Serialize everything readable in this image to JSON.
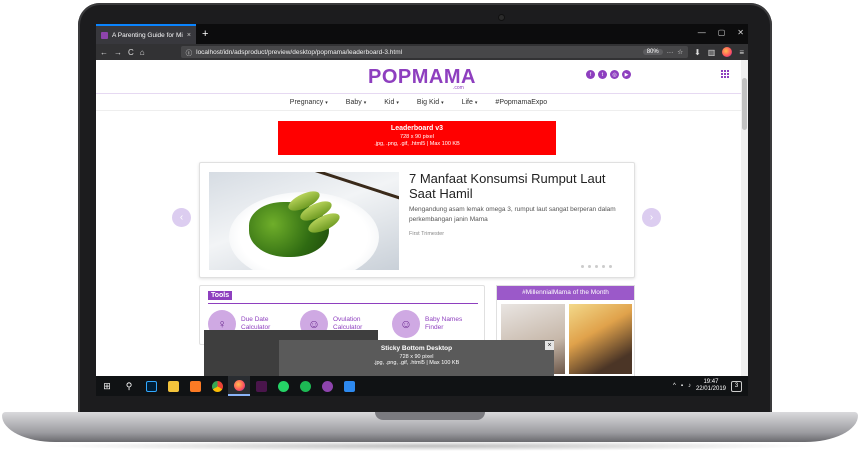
{
  "browser": {
    "tab_title": "A Parenting Guide for Millennial",
    "url": "localhost/idn/adsproduct/preview/desktop/popmama/leaderboard-3.html",
    "zoom": "80%",
    "newtab_symbol": "+",
    "close_symbol": "×",
    "back_symbol": "←",
    "forward_symbol": "→",
    "reload_symbol": "C",
    "home_symbol": "⌂",
    "info_symbol": "ⓘ",
    "more_symbol": "···",
    "bookmark_symbol": "☆",
    "menu_symbol": "≡",
    "downloads_symbol": "⬇",
    "library_symbol": "▥",
    "min_symbol": "—",
    "max_symbol": "▢",
    "winclose_symbol": "✕"
  },
  "site": {
    "logo": "POPMAMA",
    "logo_sub": ".com",
    "social": [
      "f",
      "t",
      "◎",
      "▶"
    ],
    "menu": [
      {
        "label": "Pregnancy",
        "caret": "▾"
      },
      {
        "label": "Baby",
        "caret": "▾"
      },
      {
        "label": "Kid",
        "caret": "▾"
      },
      {
        "label": "Big Kid",
        "caret": "▾"
      },
      {
        "label": "Life",
        "caret": "▾"
      },
      {
        "label": "#PopmamaExpo",
        "caret": ""
      }
    ]
  },
  "leaderboard": {
    "title": "Leaderboard v3",
    "size": "728 x 90 pixel",
    "format": ".jpg, .png, .gif, .html5 | Max 100 KB"
  },
  "hero": {
    "title": "7 Manfaat Konsumsi Rumput Laut Saat Hamil",
    "description": "Mengandung asam lemak omega 3, rumput laut sangat berperan dalam perkembangan janin Mama",
    "category": "First Trimester",
    "prev_arrow": "‹",
    "next_arrow": "›"
  },
  "tools": {
    "title": "Tools",
    "items": [
      {
        "label": "Due Date Calculator",
        "icon": "mother-icon",
        "glyph": "♀"
      },
      {
        "label": "Ovulation Calculator",
        "icon": "baby-icon",
        "glyph": "☺"
      },
      {
        "label": "Baby Names Finder",
        "icon": "baby-name-icon",
        "glyph": "☺"
      }
    ]
  },
  "millennial_mama": {
    "title": "#MillennialMama of the Month"
  },
  "sticky": {
    "title": "Sticky Bottom Desktop",
    "size": "728 x 90 pixel",
    "format": ".jpg, .png, .gif, .html5 | Max 100 KB",
    "close": "×"
  },
  "taskbar": {
    "start_symbol": "⊞",
    "search_symbol": "⚲",
    "apps": [
      {
        "name": "photoshop",
        "color": "#001e36"
      },
      {
        "name": "file-explorer",
        "color": "#f3c33b"
      },
      {
        "name": "xampp",
        "color": "#fb7a24"
      },
      {
        "name": "chrome",
        "color": "#4caf50"
      },
      {
        "name": "firefox",
        "color": "#ff7139"
      },
      {
        "name": "slack",
        "color": "#4a154b"
      },
      {
        "name": "whatsapp",
        "color": "#25d366"
      },
      {
        "name": "spotify",
        "color": "#1db954"
      },
      {
        "name": "app-purple",
        "color": "#8e44ad"
      },
      {
        "name": "app-blue",
        "color": "#2d89ef"
      }
    ],
    "time": "19:47",
    "date": "22/01/2019",
    "notifications": "3"
  },
  "colors": {
    "brand": "#8e3fbf",
    "leaderboard": "#ff0000"
  }
}
